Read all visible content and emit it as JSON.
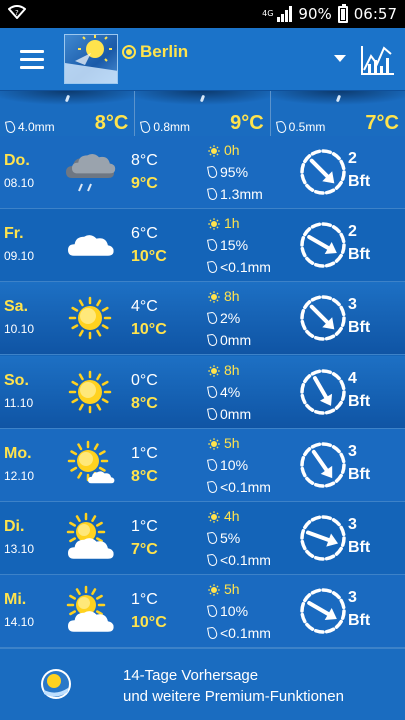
{
  "status": {
    "network": "4G",
    "battery": "90%",
    "time": "06:57"
  },
  "header": {
    "city": "Berlin"
  },
  "hourly": [
    {
      "precip": "4.0mm",
      "temp": "8°C"
    },
    {
      "precip": "0.8mm",
      "temp": "9°C"
    },
    {
      "precip": "0.5mm",
      "temp": "7°C"
    }
  ],
  "days": [
    {
      "day": "Do.",
      "date": "08.10",
      "icon": "rain-cloud-icon",
      "tmin": "8°C",
      "tmax": "9°C",
      "sun": "0h",
      "prob": "95%",
      "amount": "1.3mm",
      "bft": "2",
      "unit": "Bft"
    },
    {
      "day": "Fr.",
      "date": "09.10",
      "icon": "cloud-icon",
      "tmin": "6°C",
      "tmax": "10°C",
      "sun": "1h",
      "prob": "15%",
      "amount": "<0.1mm",
      "bft": "2",
      "unit": "Bft"
    },
    {
      "day": "Sa.",
      "date": "10.10",
      "icon": "sun-icon",
      "tmin": "4°C",
      "tmax": "10°C",
      "sun": "8h",
      "prob": "2%",
      "amount": "0mm",
      "bft": "3",
      "unit": "Bft"
    },
    {
      "day": "So.",
      "date": "11.10",
      "icon": "sun-icon",
      "tmin": "0°C",
      "tmax": "8°C",
      "sun": "8h",
      "prob": "4%",
      "amount": "0mm",
      "bft": "4",
      "unit": "Bft"
    },
    {
      "day": "Mo.",
      "date": "12.10",
      "icon": "sun-small-cloud-icon",
      "tmin": "1°C",
      "tmax": "8°C",
      "sun": "5h",
      "prob": "10%",
      "amount": "<0.1mm",
      "bft": "3",
      "unit": "Bft"
    },
    {
      "day": "Di.",
      "date": "13.10",
      "icon": "partly-cloudy-icon",
      "tmin": "1°C",
      "tmax": "7°C",
      "sun": "4h",
      "prob": "5%",
      "amount": "<0.1mm",
      "bft": "3",
      "unit": "Bft"
    },
    {
      "day": "Mi.",
      "date": "14.10",
      "icon": "partly-cloudy-icon",
      "tmin": "1°C",
      "tmax": "10°C",
      "sun": "5h",
      "prob": "10%",
      "amount": "<0.1mm",
      "bft": "3",
      "unit": "Bft"
    }
  ],
  "footer": {
    "line1": "14-Tage Vorhersage",
    "line2": "und weitere Premium-Funktionen"
  }
}
